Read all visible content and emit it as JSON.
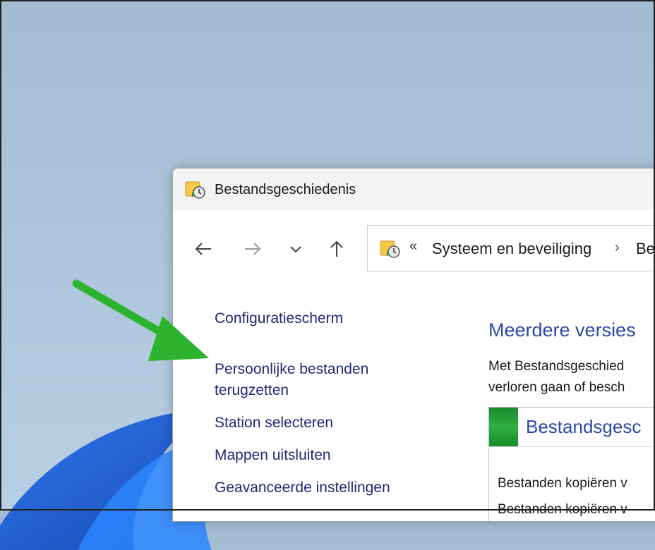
{
  "window": {
    "title": "Bestandsgeschiedenis",
    "icon": "file-history-icon"
  },
  "navigation": {
    "back_icon": "back-arrow-icon",
    "forward_icon": "forward-arrow-icon",
    "recent_icon": "chevron-down-icon",
    "up_icon": "up-arrow-icon",
    "address": {
      "overflow": "«",
      "crumbs": [
        "Systeem en beveiliging",
        "Be"
      ],
      "separator": "›"
    }
  },
  "sidebar": {
    "items": [
      {
        "label": "Configuratiescherm"
      },
      {
        "label_line1": "Persoonlijke bestanden",
        "label_line2": "terugzetten"
      },
      {
        "label": "Station selecteren"
      },
      {
        "label": "Mappen uitsluiten"
      },
      {
        "label": "Geavanceerde instellingen"
      }
    ]
  },
  "main": {
    "heading": "Meerdere versies",
    "desc_line1": "Met Bestandsgeschied",
    "desc_line2": "verloren gaan of besch",
    "panel": {
      "title": "Bestandsgesc",
      "line1": "Bestanden kopiëren v",
      "line2": "Bestanden kopiëren v"
    }
  },
  "annotation": {
    "arrow_color": "#2db32d"
  },
  "colors": {
    "link": "#1f2a77",
    "heading": "#2b4aa8",
    "accent_green": "#2fb043"
  }
}
